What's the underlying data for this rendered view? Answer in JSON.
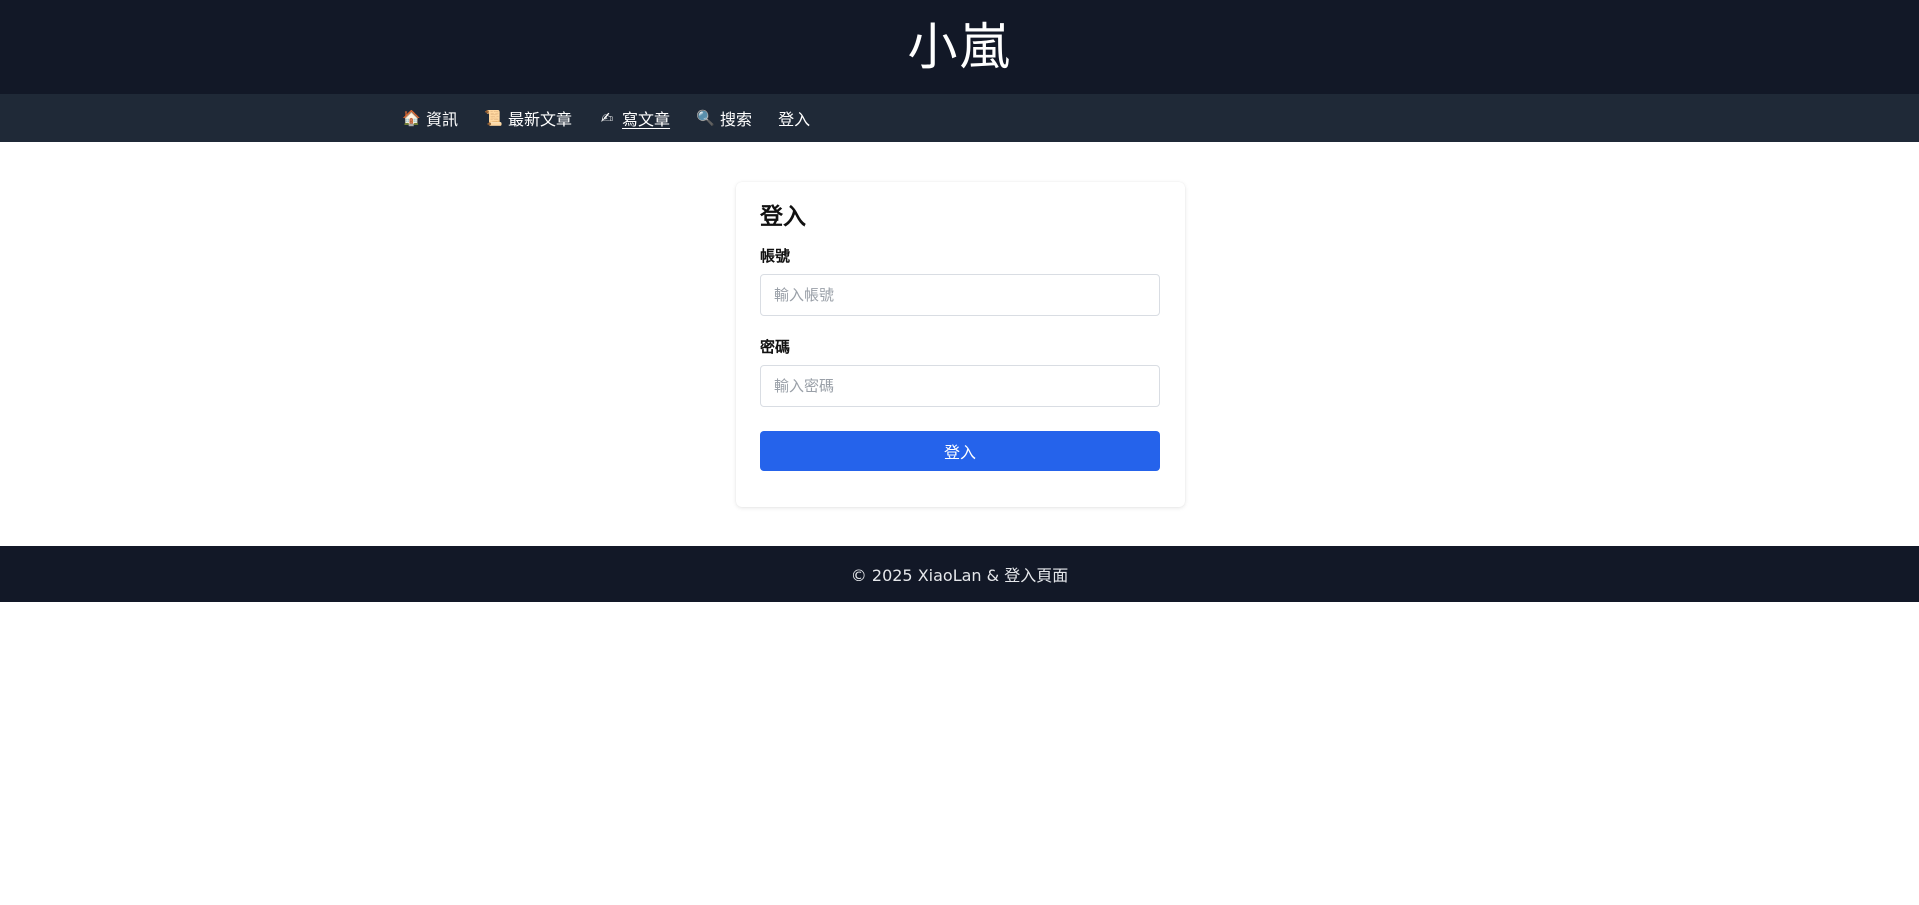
{
  "header": {
    "title": "小嵐"
  },
  "nav": {
    "items": [
      {
        "icon": "🏠",
        "icon_name": "house-icon",
        "label": "資訊"
      },
      {
        "icon": "📜",
        "icon_name": "scroll-icon",
        "label": "最新文章"
      },
      {
        "icon": "✍",
        "icon_name": "writing-hand-icon",
        "label": "寫文章",
        "active": true
      },
      {
        "icon": "🔍",
        "icon_name": "magnifier-icon",
        "label": "搜索"
      },
      {
        "label": "登入"
      }
    ]
  },
  "login": {
    "title": "登入",
    "username": {
      "label": "帳號",
      "placeholder": "輸入帳號",
      "value": ""
    },
    "password": {
      "label": "密碼",
      "placeholder": "輸入密碼",
      "value": ""
    },
    "submit_label": "登入"
  },
  "footer": {
    "text": "© 2025 XiaoLan & 登入頁面"
  },
  "colors": {
    "header_bg": "#121827",
    "nav_bg": "#1f2937",
    "accent": "#2563eb"
  }
}
